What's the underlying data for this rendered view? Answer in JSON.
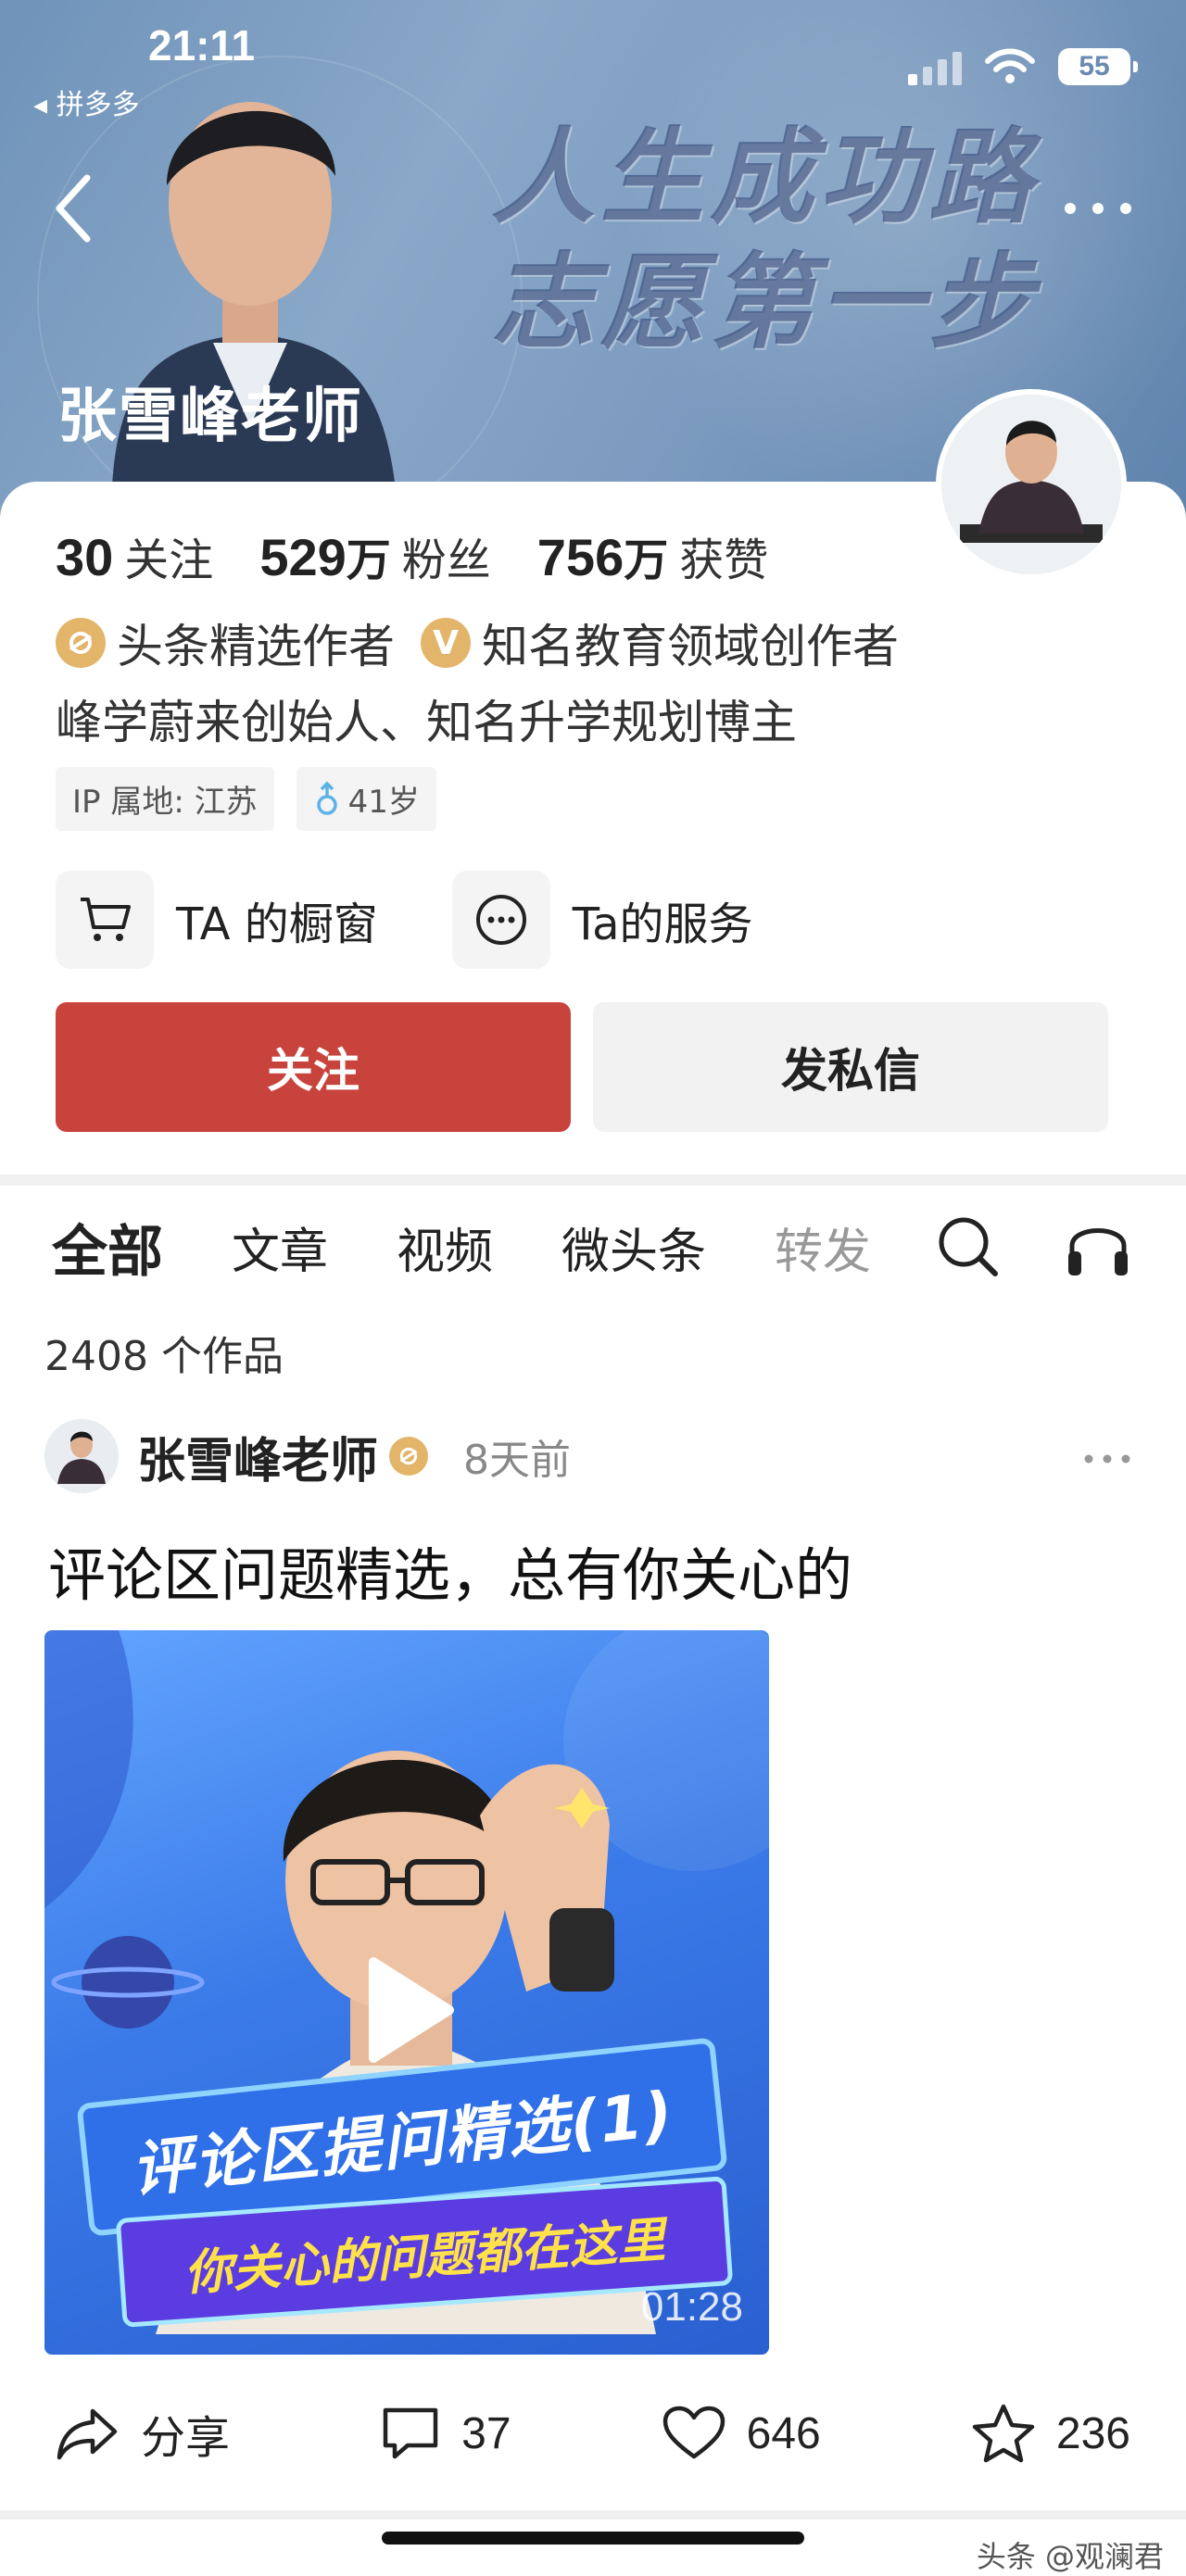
{
  "status_bar": {
    "time": "21:11",
    "back_app": "◂ 拼多多",
    "battery": "55"
  },
  "banner": {
    "slogan_line1": "人生成功路",
    "slogan_line2": "志愿第一步",
    "author_name": "张雪峰老师"
  },
  "stats": [
    {
      "num": "30",
      "unit": "",
      "label": "关注"
    },
    {
      "num": "529",
      "unit": "万",
      "label": "粉丝"
    },
    {
      "num": "756",
      "unit": "万",
      "label": "获赞"
    }
  ],
  "badges": {
    "toutiao": "头条精选作者",
    "verified": "知名教育领域创作者"
  },
  "bio": "峰学蔚来创始人、知名升学规划博主",
  "tags": {
    "ip": "IP 属地: 江苏",
    "age": "41岁"
  },
  "shop": {
    "window": "TA 的橱窗",
    "service": "Ta的服务"
  },
  "buttons": {
    "follow": "关注",
    "message": "发私信"
  },
  "tabs": [
    "全部",
    "文章",
    "视频",
    "微头条",
    "转发"
  ],
  "works_count": "2408 个作品",
  "post": {
    "author": "张雪峰老师",
    "time": "8天前",
    "title": "评论区问题精选，总有你关心的",
    "video": {
      "caption1": "评论区提问精选(1)",
      "caption2": "你关心的问题都在这里",
      "duration": "01:28"
    },
    "actions": {
      "share": "分享",
      "comments": "37",
      "likes": "646",
      "stars": "236"
    }
  },
  "watermark": "头条 @观澜君",
  "colors": {
    "accent_red": "#c9433d",
    "gold_badge": "#e2b56b",
    "banner_blue": "#7d9cc0"
  }
}
